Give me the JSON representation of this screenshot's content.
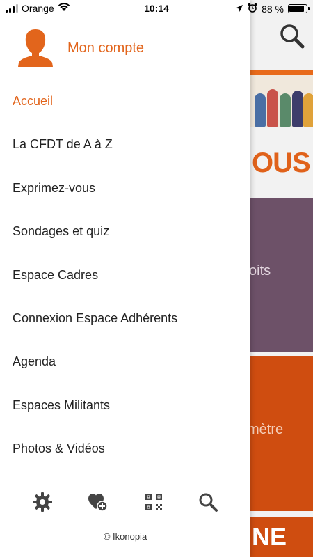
{
  "status_bar": {
    "carrier": "Orange",
    "time": "10:14",
    "battery": "88 %",
    "battery_level": 0.88
  },
  "drawer": {
    "account_label": "Mon compte",
    "menu": [
      {
        "label": "Accueil",
        "active": true
      },
      {
        "label": "La CFDT de A à Z",
        "active": false
      },
      {
        "label": "Exprimez-vous",
        "active": false
      },
      {
        "label": "Sondages et quiz",
        "active": false
      },
      {
        "label": "Espace Cadres",
        "active": false
      },
      {
        "label": "Connexion Espace Adhérents",
        "active": false
      },
      {
        "label": "Agenda",
        "active": false
      },
      {
        "label": "Espaces Militants",
        "active": false
      },
      {
        "label": "Photos & Vidéos",
        "active": false
      }
    ],
    "bottom_icons": [
      "gear-icon",
      "heart-add-icon",
      "qr-code-icon",
      "search-icon"
    ],
    "copyright": "© Ikonopia"
  },
  "background": {
    "tile_text_1": "OUS",
    "tile_text_2": "oits",
    "tile_text_3": "mètre",
    "tile_text_4": "NE"
  },
  "colors": {
    "accent": "#e2651c",
    "purple_tile": "#6d5168",
    "orange_tile": "#cf4d10"
  }
}
